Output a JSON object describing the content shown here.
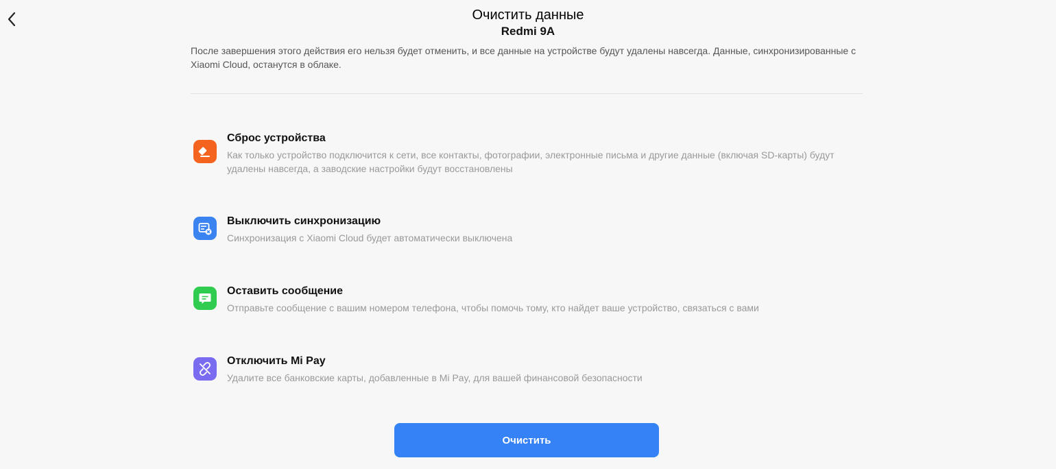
{
  "header": {
    "title": "Очистить данные",
    "back_icon": "chevron-left-icon",
    "device_name": "Redmi 9A"
  },
  "notice": "После завершения этого действия его нельзя будет отменить, и все данные на устройстве будут удалены навсегда. Данные, синхронизированные с Xiaomi Cloud, останутся в облаке.",
  "items": [
    {
      "icon": "eraser-icon",
      "color": "#f5641e",
      "title": "Сброс устройства",
      "description": "Как только устройство подключится к сети, все контакты, фотографии, электронные письма и другие данные (включая SD-карты) будут удалены навсегда, а заводские настройки будут восстановлены"
    },
    {
      "icon": "sync-off-icon",
      "color": "#3a83f0",
      "title": "Выключить синхронизацию",
      "description": "Синхронизация с Xiaomi Cloud будет автоматически выключена"
    },
    {
      "icon": "message-icon",
      "color": "#2fcc4f",
      "title": "Оставить сообщение",
      "description": "Отправьте сообщение с вашим номером телефона, чтобы помочь тому, кто найдет ваше устройство, связаться с вами"
    },
    {
      "icon": "unlink-icon",
      "color": "#7a6cf0",
      "title": "Отключить Mi Pay",
      "description": "Удалите все банковские карты, добавленные в Mi Pay, для вашей финансовой безопасности"
    }
  ],
  "action": {
    "clear_label": "Очистить",
    "color": "#3482f5"
  }
}
